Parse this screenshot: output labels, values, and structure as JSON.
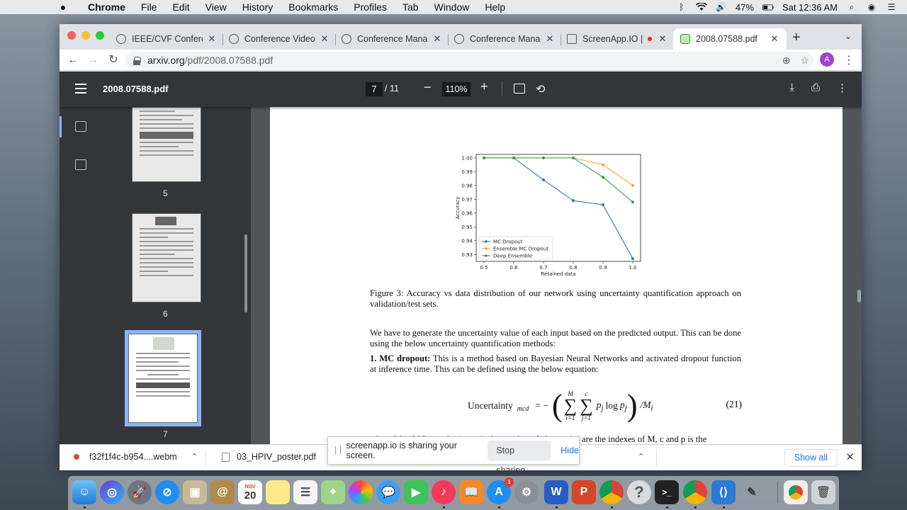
{
  "menubar": {
    "apple": "",
    "app": "Chrome",
    "items": [
      "File",
      "Edit",
      "View",
      "History",
      "Bookmarks",
      "Profiles",
      "Tab",
      "Window",
      "Help"
    ],
    "battery": "47%",
    "clock": "Sat 12:36 AM",
    "icons": [
      "bluetooth-icon",
      "wifi-icon",
      "volume-icon",
      "battery-icon",
      "spotlight-icon",
      "siri-icon",
      "control-icon"
    ]
  },
  "tabs": [
    {
      "title": "IEEE/CVF Conference",
      "icon": "globe-icon"
    },
    {
      "title": "Conference Video U",
      "icon": "globe-icon"
    },
    {
      "title": "Conference Manage",
      "icon": "globe-icon"
    },
    {
      "title": "Conference Manage",
      "icon": "globe-icon"
    },
    {
      "title": "ScreenApp.IO |",
      "icon": "screenapp-icon"
    },
    {
      "title": "2008.07588.pdf",
      "icon": "arxiv-icon"
    }
  ],
  "address": {
    "host": "arxiv.org",
    "path": "/pdf/2008.07588.pdf"
  },
  "profile_initial": "A",
  "pdf": {
    "title": "2008.07588.pdf",
    "page_current": "7",
    "page_total": "/ 11",
    "zoom": "110%",
    "thumbnails": [
      {
        "label": "5"
      },
      {
        "label": "6"
      },
      {
        "label": "7"
      }
    ]
  },
  "page_content": {
    "figure_caption": "Figure 3: Accuracy vs data distribution of our network using uncertainty quantification approach on validation/test sets.",
    "paragraph1": "We have to generate the uncertainty value of each input based on the predicted output. This can be done using the below uncertainty quantification methods:",
    "mc_heading": "1. MC dropout:",
    "mc_text": " This is a method based on Bayesian Neural Networks and activated dropout function at inference time. This can be defined using the below equation:",
    "equation_label": "Uncertainty",
    "equation_sub": "mcd",
    "equation_number": "(21)",
    "cut_line": "where  M  is MC sample size,  c  is the number of classes,  i, j  are the indexes of  M, c  and  p",
    "cut_line_end": "  is the"
  },
  "chart_data": {
    "type": "line",
    "title": "",
    "xlabel": "Retained data",
    "ylabel": "Accuracy",
    "x": [
      0.5,
      0.6,
      0.7,
      0.8,
      0.9,
      1.0
    ],
    "xlim": [
      0.5,
      1.0
    ],
    "ylim": [
      0.925,
      1.0025
    ],
    "yticks": [
      "0.93",
      "0.94",
      "0.95",
      "0.96",
      "0.97",
      "0.98",
      "0.99",
      "1.00"
    ],
    "xticks": [
      "0.5",
      "0.6",
      "0.7",
      "0.8",
      "0.9",
      "1.0"
    ],
    "legend_position": "lower-left",
    "series": [
      {
        "name": "MC Dropout",
        "color": "#3a6fb0",
        "values": [
          1.0,
          1.0,
          0.984,
          0.969,
          0.966,
          0.927
        ]
      },
      {
        "name": "Ensemble MC Dropout",
        "color": "#f4a14a",
        "values": [
          1.0,
          1.0,
          1.0,
          1.0,
          0.995,
          0.98
        ]
      },
      {
        "name": "Deep Ensemble",
        "color": "#3a9a4a",
        "values": [
          1.0,
          1.0,
          1.0,
          1.0,
          0.986,
          0.968
        ]
      }
    ]
  },
  "downloads": {
    "item1": "f32f1f4c-b954....webm",
    "item2": "03_HPIV_poster.pdf",
    "sharing_text": "screenapp.io is sharing your screen.",
    "stop_label": "Stop sharing",
    "hide_label": "Hide",
    "show_all": "Show all"
  },
  "dock": {
    "calendar_month": "NOV",
    "calendar_day": "20",
    "appstore_badge": "1"
  }
}
